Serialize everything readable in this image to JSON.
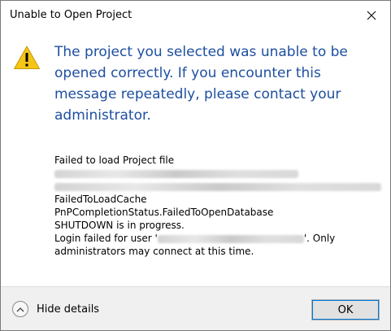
{
  "window": {
    "title": "Unable to Open Project"
  },
  "icons": {
    "warning": "warning-triangle-icon",
    "close": "close-icon",
    "chevron": "chevron-up-icon"
  },
  "colors": {
    "instruction_text": "#1e4fa0",
    "warning_fill": "#f5c518",
    "footer_background": "#f0f0f0",
    "button_focus": "#0078d7"
  },
  "message": {
    "main_instruction": "The project you selected was unable to be opened correctly. If you encounter this message repeatedly, please contact your administrator."
  },
  "details": {
    "line1": "Failed to load Project file",
    "line4": "FailedToLoadCache",
    "line5": "PnPCompletionStatus.FailedToOpenDatabase",
    "line6": "SHUTDOWN is in progress.",
    "line7_prefix": "Login failed for user '",
    "line7_suffix": "'. Only",
    "line8": "administrators may connect at this time."
  },
  "footer": {
    "toggle_label": "Hide details",
    "ok_label": "OK"
  }
}
